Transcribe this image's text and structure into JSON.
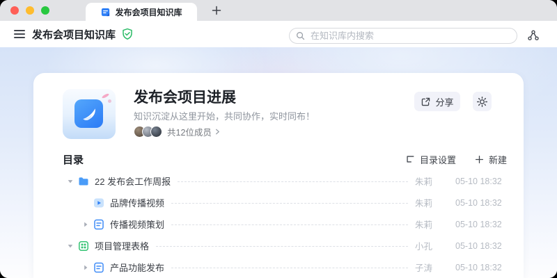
{
  "tab": {
    "title": "发布会项目知识库"
  },
  "header": {
    "title": "发布会项目知识库",
    "search_placeholder": "在知识库内搜索"
  },
  "hero": {
    "title": "发布会项目进展",
    "subtitle": "知识沉淀从这里开始，共同协作，实时同布！",
    "members_label": "共12位成员",
    "share_label": "分享"
  },
  "directory": {
    "title": "目录",
    "settings_label": "目录设置",
    "new_label": "新建",
    "rows": [
      {
        "name": "22 发布会工作周报",
        "icon": "folder",
        "chevron": "down",
        "level": 0,
        "author": "朱莉",
        "date": "05-10 18:32"
      },
      {
        "name": "品牌传播视频",
        "icon": "video",
        "chevron": "none",
        "level": 1,
        "author": "朱莉",
        "date": "05-10 18:32"
      },
      {
        "name": "传播视频策划",
        "icon": "doc",
        "chevron": "right",
        "level": 1,
        "author": "朱莉",
        "date": "05-10 18:32"
      },
      {
        "name": "项目管理表格",
        "icon": "table",
        "chevron": "down",
        "level": 0,
        "author": "小孔",
        "date": "05-10 18:32"
      },
      {
        "name": "产品功能发布",
        "icon": "doc",
        "chevron": "right",
        "level": 1,
        "author": "子涛",
        "date": "05-10 18:32"
      }
    ]
  },
  "colors": {
    "traffic-red": "#ff5f57",
    "traffic-yellow": "#febc2e",
    "traffic-green": "#28c840",
    "accent-blue": "#3f8cf7",
    "accent-green": "#35c373",
    "banner-blue": "#d6e3f8"
  }
}
